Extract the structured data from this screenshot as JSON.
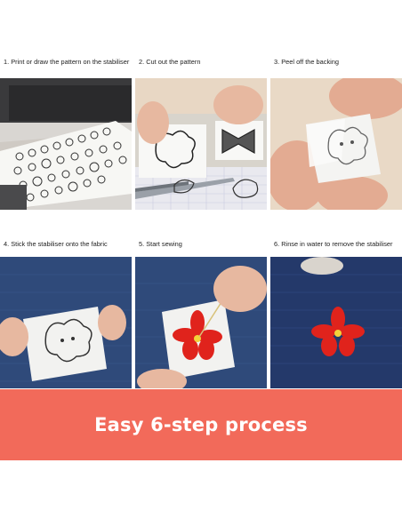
{
  "steps": [
    {
      "caption": "1. Print or draw the pattern on the stabiliser"
    },
    {
      "caption": "2. Cut out the pattern"
    },
    {
      "caption": "3. Peel off the backing"
    },
    {
      "caption": "4. Stick the stabiliser onto the fabric"
    },
    {
      "caption": "5. Start sewing"
    },
    {
      "caption": "6. Rinse in water to remove the stabiliser"
    }
  ],
  "banner": {
    "text": "Easy 6-step process",
    "color": "#f26a5a"
  },
  "colors": {
    "fabric": "#2f4a7a",
    "stabiliser": "#f2f2f0",
    "skin": "#e7b8a0",
    "flower_thread": "#e0231c"
  }
}
